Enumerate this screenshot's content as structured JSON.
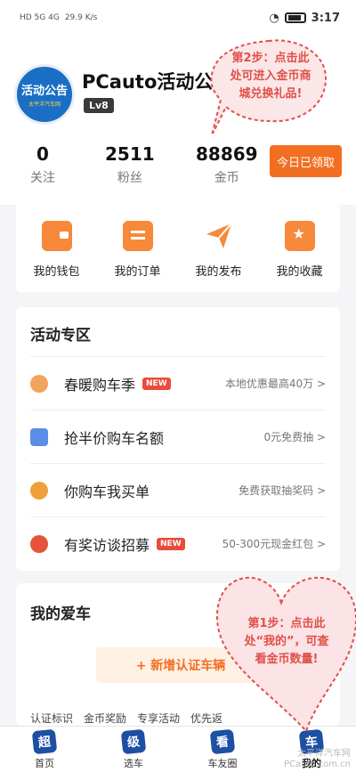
{
  "statusbar": {
    "left_info": "HD 5G 4G",
    "speed": "29.9 K/s",
    "time": "3:17"
  },
  "profile": {
    "avatar_text": "活动公告",
    "avatar_sub": "太平洋汽车网",
    "name": "PCauto活动公",
    "level": "Lv8"
  },
  "stats": [
    {
      "value": "0",
      "label": "关注"
    },
    {
      "value": "2511",
      "label": "粉丝"
    },
    {
      "value": "88869",
      "label": "金币"
    }
  ],
  "claim_button": "今日已领取",
  "actions": [
    {
      "label": "我的钱包",
      "icon": "wallet-icon"
    },
    {
      "label": "我的订单",
      "icon": "order-icon"
    },
    {
      "label": "我的发布",
      "icon": "paper-plane-icon"
    },
    {
      "label": "我的收藏",
      "icon": "star-folder-icon"
    }
  ],
  "activity": {
    "title": "活动专区",
    "items": [
      {
        "name": "春暖购车季",
        "new": "NEW",
        "desc": "本地优惠最高40万 >",
        "color": "#f2a35c"
      },
      {
        "name": "抢半价购车名额",
        "new": "",
        "desc": "0元免费抽 >",
        "color": "#5b8de6"
      },
      {
        "name": "你购车我买单",
        "new": "",
        "desc": "免费获取抽奖码 >",
        "color": "#f0a03a"
      },
      {
        "name": "有奖访谈招募",
        "new": "NEW",
        "desc": "50-300元现金红包 >",
        "color": "#e6533b"
      }
    ]
  },
  "mycar": {
    "title": "我的爱车",
    "add_button": "+ 新增认证车辆",
    "tools": [
      "认证标识",
      "金币奖励",
      "专享活动",
      "优先返",
      ""
    ]
  },
  "tabs": [
    {
      "glyph": "超",
      "label": "首页"
    },
    {
      "glyph": "级",
      "label": "选车"
    },
    {
      "glyph": "看",
      "label": "车友圈"
    },
    {
      "glyph": "车",
      "label": "我的"
    }
  ],
  "annotations": {
    "step2": "第2步：点击此处可进入金币商城兑换礼品!",
    "step1": "第1步：点击此处“我的”，可查看金币数量!"
  },
  "watermark": {
    "line1": "太平洋汽车网",
    "line2": "PCauto.com.cn"
  },
  "colors": {
    "accent": "#f26f21",
    "annotation": "#e0504a",
    "tab_icon": "#1d4fa3"
  }
}
